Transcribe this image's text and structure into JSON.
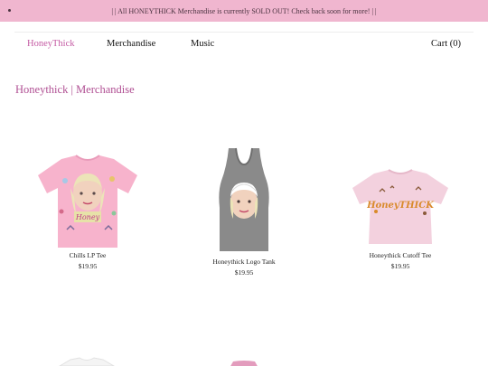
{
  "announcement": {
    "text": "| | All HONEYTHICK Merchandise is currently SOLD OUT! Check back soon for more! | |"
  },
  "nav": {
    "brand": "HoneyThick",
    "merchandise": "Merchandise",
    "music": "Music",
    "cart": "Cart (0)"
  },
  "page": {
    "title": "Honeythick | Merchandise"
  },
  "products": [
    {
      "name": "Chills LP Tee",
      "price": "$19.95"
    },
    {
      "name": "Honeythick Logo Tank",
      "price": "$19.95"
    },
    {
      "name": "Honeythick Cutoff Tee",
      "price": "$19.95"
    }
  ],
  "colors": {
    "announcement_bg": "#f0b6cf",
    "brand_pink": "#c45aa3",
    "title_pink": "#b04f93",
    "tee_pink": "#f7b3cc",
    "tank_gray": "#8a8a8a",
    "crop_pink": "#f3d1de"
  }
}
